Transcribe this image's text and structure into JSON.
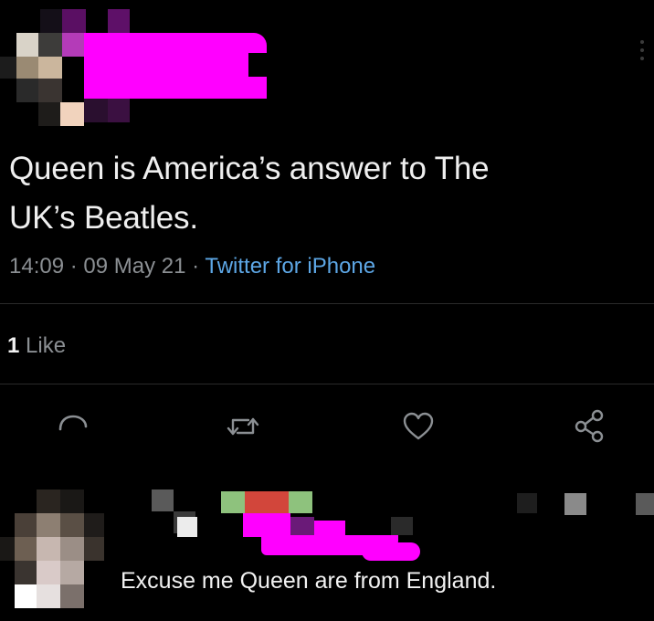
{
  "tweet": {
    "text_line1": "Queen is America’s answer to The",
    "text_line2": "UK’s Beatles.",
    "time": "14:09",
    "separator": " · ",
    "date": "09 May 21",
    "source": "Twitter for iPhone",
    "like_count": "1",
    "like_label": " Like"
  },
  "reply": {
    "text": "Excuse me Queen are from England."
  },
  "icons": {
    "reply": "reply-icon",
    "retweet": "retweet-icon",
    "like": "heart-icon",
    "share": "share-icon",
    "more": "more-options-icon"
  },
  "colors": {
    "background": "#000000",
    "link": "#5da7e6",
    "muted": "#8b8f93",
    "redaction": "#ff00ff"
  }
}
